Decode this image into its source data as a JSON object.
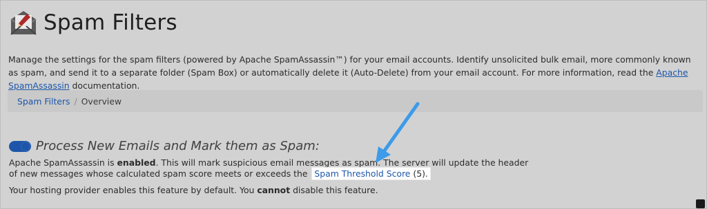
{
  "header": {
    "title": "Spam Filters",
    "icon": "envelope-pencil-icon"
  },
  "description": {
    "text": "Manage the settings for the spam filters (powered by Apache SpamAssassin™) for your email accounts. Identify unsolicited bulk email, more commonly known as spam, and send it to a separate folder (Spam Box) or automatically delete it (Auto-Delete) from your email account. For more information, read the ",
    "link_label": "Apache SpamAssassin",
    "suffix": " documentation."
  },
  "breadcrumb": {
    "root": "Spam Filters",
    "separator": "/",
    "current": "Overview"
  },
  "section": {
    "title": "Process New Emails and Mark them as Spam:",
    "toggle_on": true,
    "line1_prefix": "Apache SpamAssassin is ",
    "line1_bold": "enabled",
    "line1_suffix": ". This will mark suspicious email messages as spam. The server will update the header",
    "line2_prefix": "of new messages whose calculated spam score meets or exceeds the ",
    "threshold_link": "Spam Threshold Score",
    "threshold_value": " (5).",
    "line3_prefix": "Your hosting provider enables this feature by default. You ",
    "line3_bold": "cannot",
    "line3_suffix": " disable this feature."
  },
  "colors": {
    "link": "#1d56a8",
    "annotation_arrow": "#3d9be9",
    "overlay_bg": "#d2d2d2"
  }
}
